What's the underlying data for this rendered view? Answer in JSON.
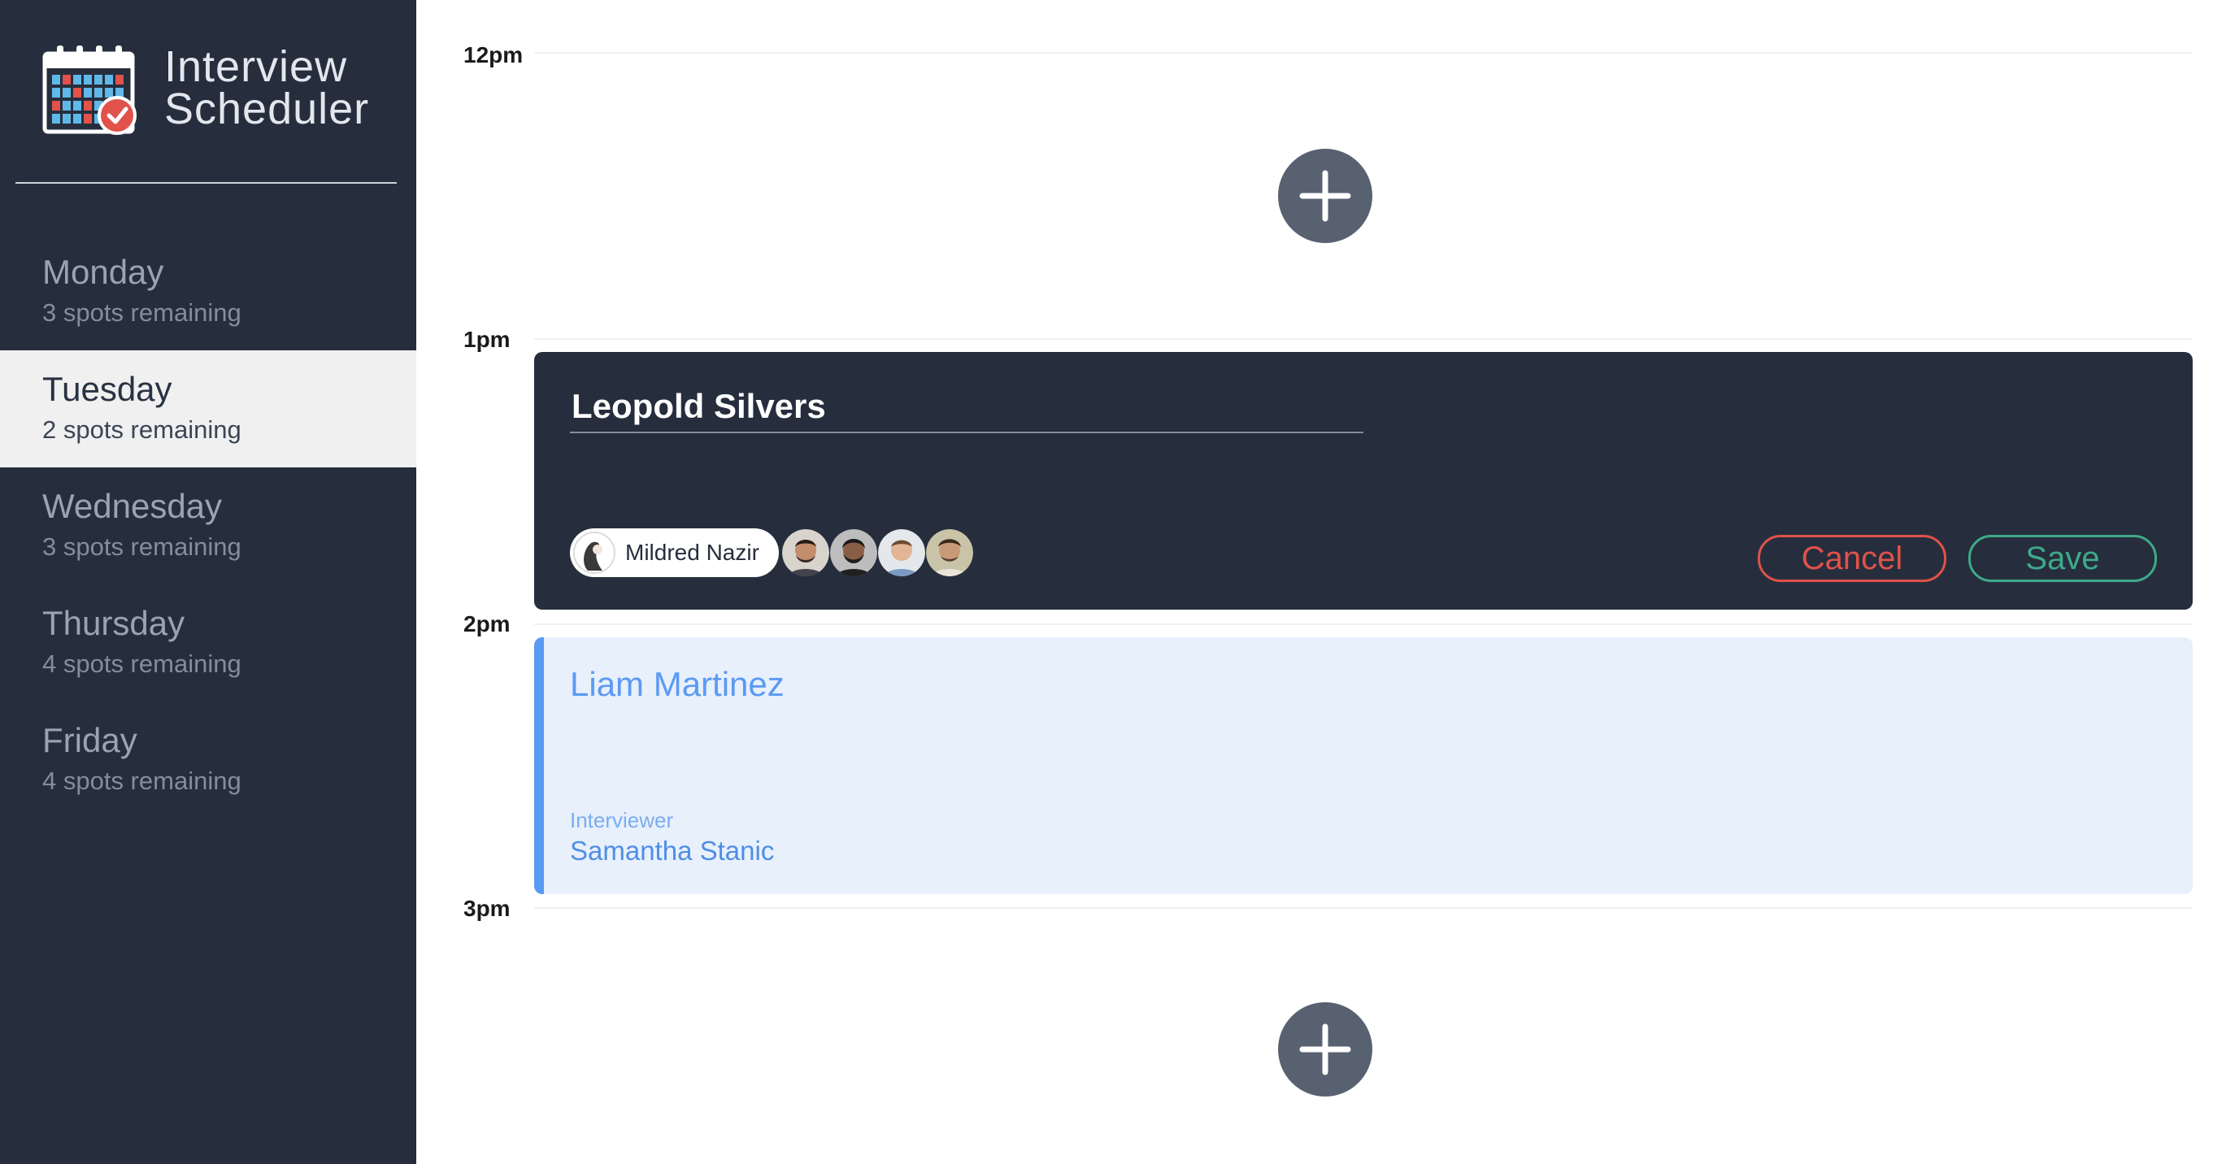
{
  "app": {
    "title_line1": "Interview",
    "title_line2": "Scheduler"
  },
  "colors": {
    "sidebar_bg": "#262e3d",
    "selected_day_bg": "#f0f0f0",
    "cancel": "#e0524a",
    "save": "#3eaa8a",
    "appointment_accent": "#5a9af3",
    "appointment_bg": "#e8f0fc"
  },
  "days": [
    {
      "name": "Monday",
      "spots": "3 spots remaining",
      "selected": false
    },
    {
      "name": "Tuesday",
      "spots": "2 spots remaining",
      "selected": true
    },
    {
      "name": "Wednesday",
      "spots": "3 spots remaining",
      "selected": false
    },
    {
      "name": "Thursday",
      "spots": "4 spots remaining",
      "selected": false
    },
    {
      "name": "Friday",
      "spots": "4 spots remaining",
      "selected": false
    }
  ],
  "schedule": {
    "times": [
      "12pm",
      "1pm",
      "2pm",
      "3pm"
    ],
    "add_icon": "plus-icon"
  },
  "form": {
    "student_name": "Leopold Silvers",
    "selected_interviewer": "Mildred Nazir",
    "interviewer_avatars": [
      "avatar-1",
      "avatar-2",
      "avatar-3",
      "avatar-4"
    ],
    "cancel_label": "Cancel",
    "save_label": "Save"
  },
  "appointment": {
    "student": "Liam Martinez",
    "interviewer_label": "Interviewer",
    "interviewer_name": "Samantha Stanic"
  }
}
